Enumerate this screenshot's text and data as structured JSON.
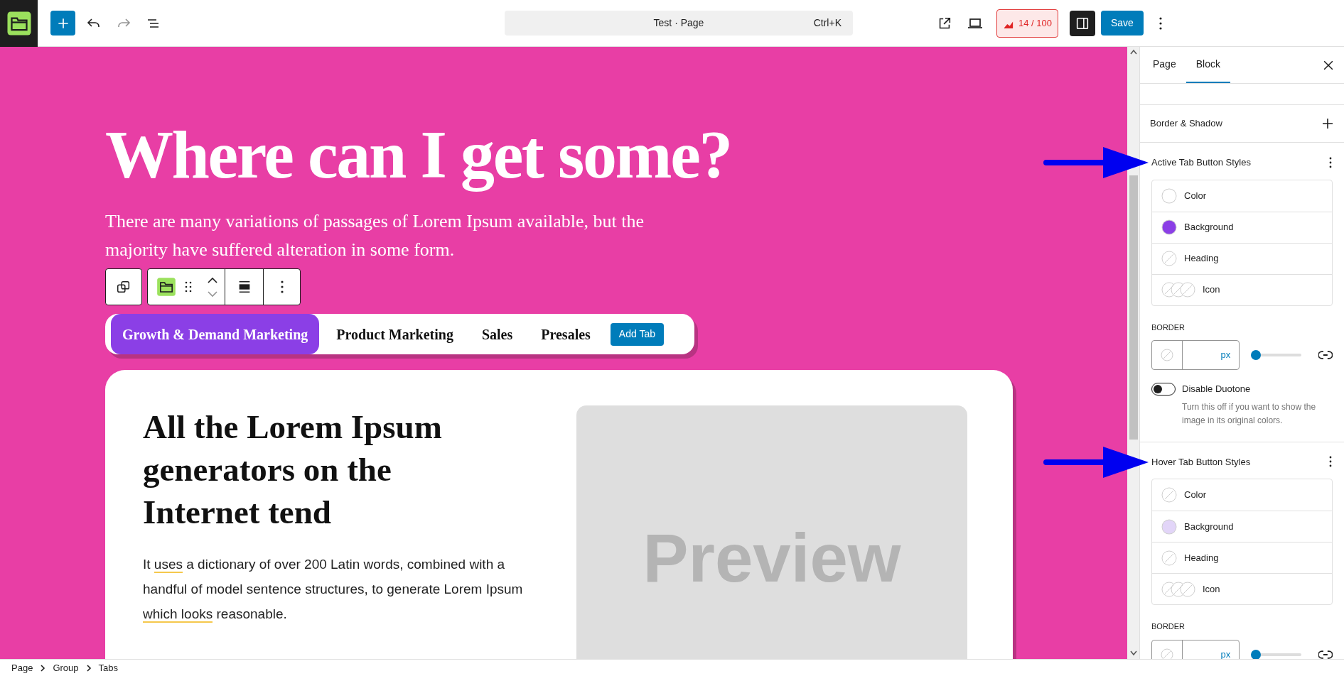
{
  "top_bar": {
    "command": "Test · Page",
    "shortcut": "Ctrl+K",
    "score": "14 / 100",
    "save": "Save"
  },
  "canvas": {
    "heading": "Where can I get some?",
    "intro": "There are many variations of passages of Lorem Ipsum available, but the majority have suffered alteration in some form."
  },
  "tabs": [
    {
      "label": "Growth & Demand Marketing",
      "selected": true
    },
    {
      "label": "Product Marketing",
      "selected": false
    },
    {
      "label": "Sales",
      "selected": false
    },
    {
      "label": "Presales",
      "selected": false
    }
  ],
  "add_tab": "Add Tab",
  "card": {
    "heading": "All the Lorem Ipsum generators on the Internet tend",
    "body": [
      {
        "text": "It ",
        "underlined": false
      },
      {
        "text": "uses",
        "underlined": true
      },
      {
        "text": " a dictionary of over 200 Latin words, combined with a handful of model sentence structures, to generate Lorem Ipsum ",
        "underlined": false
      },
      {
        "text": "which looks",
        "underlined": true
      },
      {
        "text": " reasonable.",
        "underlined": false
      }
    ],
    "preview": "Preview"
  },
  "sidebar": {
    "tabs": [
      {
        "label": "Page",
        "selected": false
      },
      {
        "label": "Block",
        "selected": true
      }
    ],
    "sections": [
      {
        "kind": "collapsed",
        "title": "Border & Shadow"
      },
      {
        "kind": "styles",
        "title": "Active Tab Button Styles",
        "items": [
          {
            "label": "Color",
            "kind": "color",
            "color": "#ffffff"
          },
          {
            "label": "Background",
            "kind": "color",
            "color": "#8b3fe6"
          },
          {
            "label": "Heading",
            "kind": "none"
          },
          {
            "label": "Icon",
            "kind": "multi"
          }
        ],
        "border_label": "BORDER",
        "unit": "px",
        "level": 0,
        "toggle": {
          "label": "Disable Duotone",
          "on": false,
          "help": "Turn this off if you want to show the image in its original colors."
        }
      },
      {
        "kind": "styles",
        "title": "Hover Tab Button Styles",
        "items": [
          {
            "label": "Color",
            "kind": "none"
          },
          {
            "label": "Background",
            "kind": "color",
            "color": "#e2d5f8"
          },
          {
            "label": "Heading",
            "kind": "none"
          },
          {
            "label": "Icon",
            "kind": "multi"
          }
        ],
        "border_label": "BORDER",
        "unit": "px",
        "level": 0
      }
    ]
  },
  "breadcrumb": [
    "Page",
    "Group",
    "Tabs"
  ]
}
